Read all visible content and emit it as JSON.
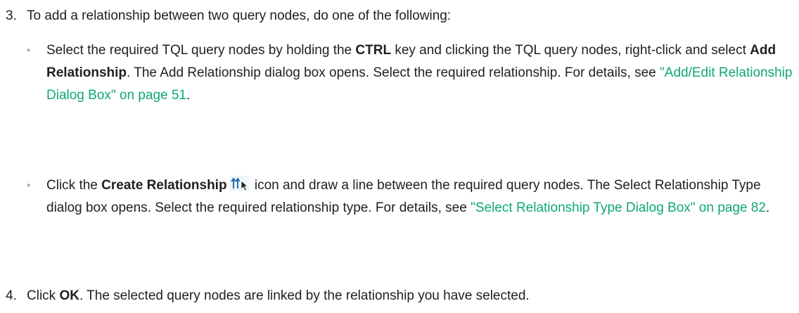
{
  "step3": {
    "number": "3.",
    "text": "To add a relationship between two query nodes, do one of the following:"
  },
  "option1": {
    "bullet": "◦",
    "part1": "Select the required TQL query nodes by holding the ",
    "bold1": "CTRL",
    "part2": " key and clicking the TQL query nodes, right-click and select ",
    "bold2": "Add Relationship",
    "part3": ". The Add Relationship dialog box opens. Select the required relationship. For details, see ",
    "link": "\"Add/Edit Relationship Dialog Box\" on page 51",
    "part4": "."
  },
  "option2": {
    "bullet": "◦",
    "part1": "Click the ",
    "bold1": "Create Relationship",
    "icon": "create-relationship-icon",
    "part2": " icon and draw a line between the required query nodes. The Select Relationship Type dialog box opens. Select the required relationship type. For details, see ",
    "link": "\"Select Relationship Type Dialog Box\" on page 82",
    "part3": "."
  },
  "step4": {
    "number": "4.",
    "part1": "Click ",
    "bold1": "OK",
    "part2": ". The selected query nodes are linked by the relationship you have selected."
  },
  "colors": {
    "link": "#0fa77a",
    "text": "#1f1f1f"
  }
}
